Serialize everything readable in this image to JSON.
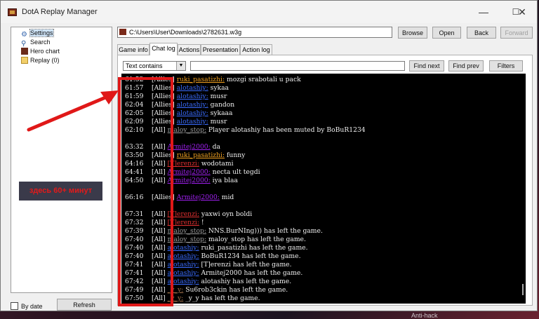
{
  "window": {
    "title": "DotA Replay Manager",
    "min": "—",
    "max": "☐",
    "close": "✕"
  },
  "sidebar": {
    "items": [
      {
        "label": "Settings",
        "icon": "gear-icon"
      },
      {
        "label": "Search",
        "icon": "magnifier-icon"
      },
      {
        "label": "Hero chart",
        "icon": "chart-icon"
      },
      {
        "label": "Replay (0)",
        "icon": "folder-icon"
      }
    ],
    "by_date_label": "By date",
    "refresh_label": "Refresh"
  },
  "toolbar": {
    "path": "C:\\Users\\User\\Downloads\\2782631.w3g",
    "browse": "Browse",
    "open": "Open",
    "back": "Back",
    "forward": "Forward"
  },
  "tabs": [
    "Game info",
    "Chat log",
    "Actions",
    "Presentation",
    "Action log"
  ],
  "active_tab": "Chat log",
  "filter": {
    "mode": "Text contains",
    "find_next": "Find next",
    "find_prev": "Find prev",
    "filters": "Filters"
  },
  "annotation": {
    "text": "здесь 60+ минут"
  },
  "colors": {
    "allies_player": "#f0a020",
    "purple_player": "#a020f0",
    "blue_player": "#3a6cff",
    "gray_player": "#9a9a9a",
    "brown_player": "#a0704a",
    "red_player": "#e03030",
    "highlight_box": "#e01818"
  },
  "chat": [
    {
      "time": "61:52",
      "channel": "[Allies]",
      "player": "ruki_pasatizhi:",
      "pcolor": "#f0a020",
      "msg": "mozgi srabotali u pack"
    },
    {
      "time": "61:57",
      "channel": "[Allies]",
      "player": "alotashiy:",
      "pcolor": "#3a6cff",
      "msg": "sykaa"
    },
    {
      "time": "61:59",
      "channel": "[Allies]",
      "player": "alotashiy:",
      "pcolor": "#3a6cff",
      "msg": "musr"
    },
    {
      "time": "62:04",
      "channel": "[Allies]",
      "player": "alotashiy:",
      "pcolor": "#3a6cff",
      "msg": "gandon"
    },
    {
      "time": "62:05",
      "channel": "[Allies]",
      "player": "alotashiy:",
      "pcolor": "#3a6cff",
      "msg": "sykaaa"
    },
    {
      "time": "62:09",
      "channel": "[Allies]",
      "player": "alotashiy:",
      "pcolor": "#3a6cff",
      "msg": "musr"
    },
    {
      "time": "62:10",
      "channel": "[All]",
      "player": "maloy_stop:",
      "pcolor": "#9a9a9a",
      "msg": "Player alotashiy has been muted by BoBuR1234"
    },
    {
      "time": "",
      "channel": "",
      "player": "",
      "pcolor": "#ffffff",
      "msg": ""
    },
    {
      "time": "63:32",
      "channel": "[All]",
      "player": "Armitej2000:",
      "pcolor": "#a020f0",
      "msg": "da"
    },
    {
      "time": "63:50",
      "channel": "[Allies]",
      "player": "ruki_pasatizhi:",
      "pcolor": "#f0a020",
      "msg": "funny"
    },
    {
      "time": "64:16",
      "channel": "[All]",
      "player": "[T]erenzi:",
      "pcolor": "#e03030",
      "msg": "wodotami"
    },
    {
      "time": "64:41",
      "channel": "[All]",
      "player": "Armitej2000:",
      "pcolor": "#a020f0",
      "msg": "necta ult tegdi"
    },
    {
      "time": "64:50",
      "channel": "[All]",
      "player": "Armitej2000:",
      "pcolor": "#a020f0",
      "msg": "iya blaa"
    },
    {
      "time": "",
      "channel": "",
      "player": "",
      "pcolor": "#ffffff",
      "msg": ""
    },
    {
      "time": "66:16",
      "channel": "[Allies]",
      "player": "Armitej2000:",
      "pcolor": "#a020f0",
      "msg": "mid"
    },
    {
      "time": "",
      "channel": "",
      "player": "",
      "pcolor": "#ffffff",
      "msg": ""
    },
    {
      "time": "67:31",
      "channel": "[All]",
      "player": "[T]erenzi:",
      "pcolor": "#e03030",
      "msg": "yaxwi oyn boldi"
    },
    {
      "time": "67:32",
      "channel": "[All]",
      "player": "[T]erenzi:",
      "pcolor": "#e03030",
      "msg": "!"
    },
    {
      "time": "67:39",
      "channel": "[All]",
      "player": "maloy_stop:",
      "pcolor": "#9a9a9a",
      "msg": "NNS.BurNIng))) has left the game."
    },
    {
      "time": "67:40",
      "channel": "[All]",
      "player": "maloy_stop:",
      "pcolor": "#9a9a9a",
      "msg": "maloy_stop has left the game."
    },
    {
      "time": "67:40",
      "channel": "[All]",
      "player": "alotashiy:",
      "pcolor": "#3a6cff",
      "msg": "ruki_pasatizhi has left the game."
    },
    {
      "time": "67:40",
      "channel": "[All]",
      "player": "alotashiy:",
      "pcolor": "#3a6cff",
      "msg": "BoBuR1234 has left the game."
    },
    {
      "time": "67:41",
      "channel": "[All]",
      "player": "alotashiy:",
      "pcolor": "#3a6cff",
      "msg": "[T]erenzi has left the game."
    },
    {
      "time": "67:41",
      "channel": "[All]",
      "player": "alotashiy:",
      "pcolor": "#3a6cff",
      "msg": "Armitej2000 has left the game."
    },
    {
      "time": "67:42",
      "channel": "[All]",
      "player": "alotashiy:",
      "pcolor": "#3a6cff",
      "msg": "alotashiy has left the game."
    },
    {
      "time": "67:49",
      "channel": "[All]",
      "player": "_y_y:",
      "pcolor": "#a0704a",
      "msg": "Su6rob3ckin has left the game."
    },
    {
      "time": "67:50",
      "channel": "[All]",
      "player": "_y_y:",
      "pcolor": "#a0704a",
      "msg": "_y_y has left the game."
    }
  ],
  "taskbar_hint": "Anti-hack"
}
